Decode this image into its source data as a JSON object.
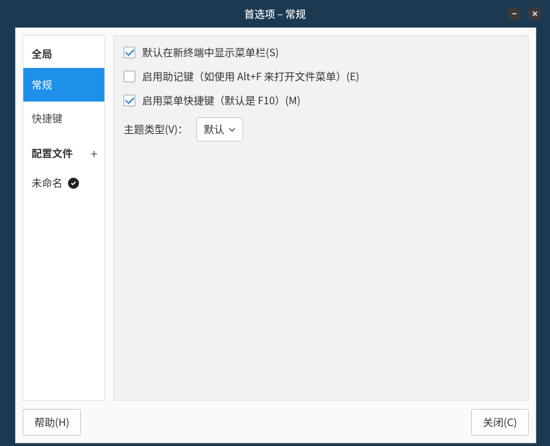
{
  "titlebar": {
    "title": "首选项 – 常规"
  },
  "sidebar": {
    "global_header": "全局",
    "items": [
      {
        "label": "常规",
        "selected": true
      },
      {
        "label": "快捷键",
        "selected": false
      }
    ],
    "profiles_header": "配置文件",
    "profiles": [
      {
        "label": "未命名"
      }
    ]
  },
  "main_panel": {
    "checks": [
      {
        "label": "默认在新终端中显示菜单栏(S)",
        "checked": true
      },
      {
        "label": "启用助记键（如使用 Alt+F 来打开文件菜单）(E)",
        "checked": false
      },
      {
        "label": "启用菜单快捷键（默认是 F10）(M)",
        "checked": true
      }
    ],
    "theme_label": "主题类型(V)：",
    "theme_value": "默认"
  },
  "buttons": {
    "help": "帮助(H)",
    "close": "关闭(C)"
  }
}
